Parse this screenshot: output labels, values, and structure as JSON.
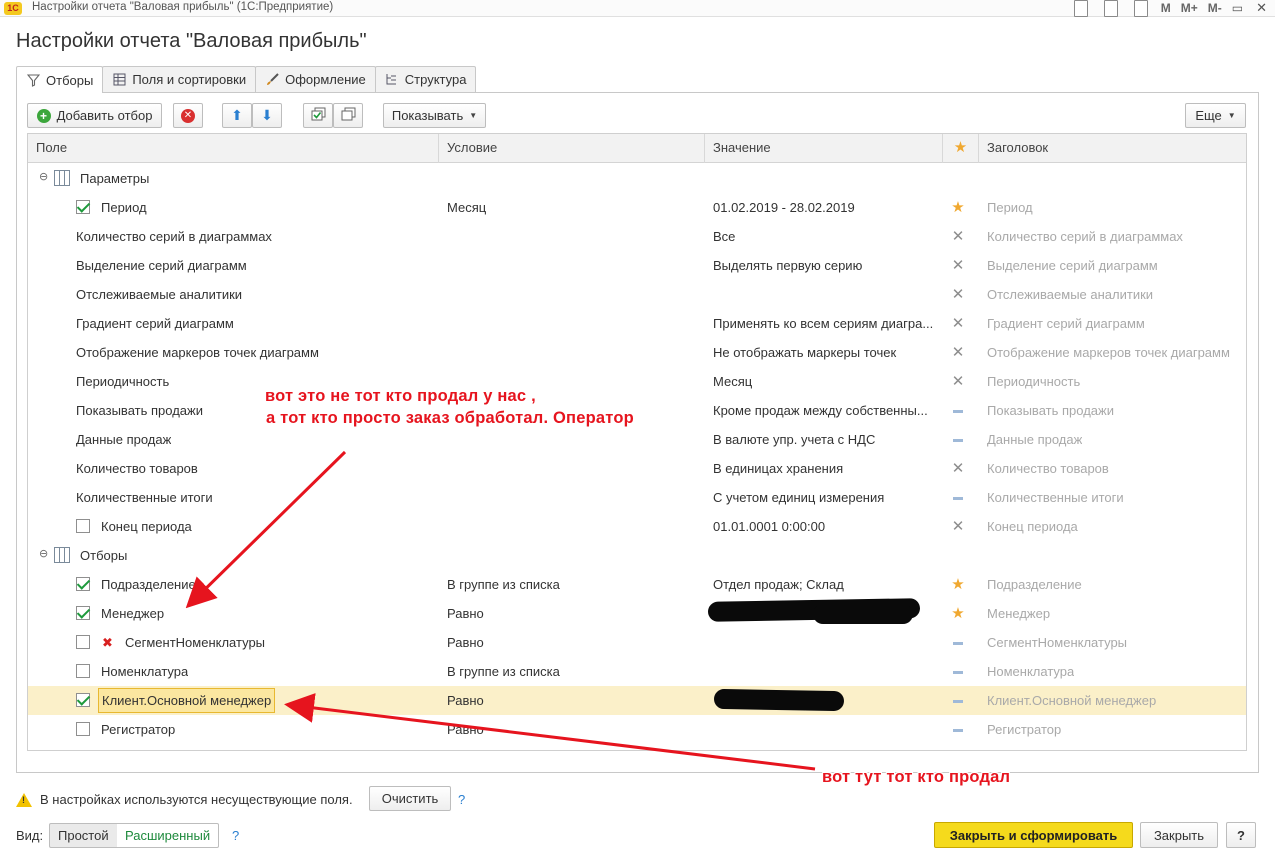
{
  "window": {
    "logo": "1С",
    "title": "Настройки отчета \"Валовая прибыль\"  (1С:Предприятие)",
    "toolbar_icons": [
      "M",
      "M+",
      "M-"
    ]
  },
  "page_title": "Настройки отчета \"Валовая прибыль\"",
  "tabs": [
    {
      "label": "Отборы",
      "icon": "filter-icon"
    },
    {
      "label": "Поля и сортировки",
      "icon": "fields-icon"
    },
    {
      "label": "Оформление",
      "icon": "brush-icon"
    },
    {
      "label": "Структура",
      "icon": "structure-icon"
    }
  ],
  "toolbar": {
    "add_filter": "Добавить отбор",
    "show": "Показывать",
    "more": "Еще"
  },
  "columns": {
    "field": "Поле",
    "condition": "Условие",
    "value": "Значение",
    "title": "Заголовок"
  },
  "groups": {
    "params": "Параметры",
    "filters": "Отборы"
  },
  "rows": [
    {
      "field": "Период",
      "condition": "Месяц",
      "value": "01.02.2019 - 28.02.2019",
      "mark": "star",
      "title": "Период"
    },
    {
      "field": "Количество серий в диаграммах",
      "condition": "",
      "value": "Все",
      "mark": "x",
      "title": "Количество серий в диаграммах"
    },
    {
      "field": "Выделение серий диаграмм",
      "condition": "",
      "value": "Выделять первую серию",
      "mark": "x",
      "title": "Выделение серий диаграмм"
    },
    {
      "field": "Отслеживаемые аналитики",
      "condition": "",
      "value": "",
      "mark": "x",
      "title": "Отслеживаемые аналитики"
    },
    {
      "field": "Градиент серий диаграмм",
      "condition": "",
      "value": "Применять ко всем сериям диагра...",
      "mark": "x",
      "title": "Градиент серий диаграмм"
    },
    {
      "field": "Отображение маркеров точек диаграмм",
      "condition": "",
      "value": "Не отображать маркеры точек",
      "mark": "x",
      "title": "Отображение маркеров точек диаграмм"
    },
    {
      "field": "Периодичность",
      "condition": "",
      "value": "Месяц",
      "mark": "x",
      "title": "Периодичность"
    },
    {
      "field": "Показывать продажи",
      "condition": "",
      "value": "Кроме продаж между собственны...",
      "mark": "dash",
      "title": "Показывать продажи"
    },
    {
      "field": "Данные продаж",
      "condition": "",
      "value": "В валюте упр. учета с НДС",
      "mark": "dash",
      "title": "Данные продаж"
    },
    {
      "field": "Количество товаров",
      "condition": "",
      "value": "В единицах хранения",
      "mark": "x",
      "title": "Количество товаров"
    },
    {
      "field": "Количественные итоги",
      "condition": "",
      "value": "С учетом единиц измерения",
      "mark": "dash",
      "title": "Количественные итоги"
    },
    {
      "field": "Конец периода",
      "condition": "",
      "value": "01.01.0001 0:00:00",
      "mark": "x",
      "title": "Конец периода"
    },
    {
      "field": "Подразделение",
      "condition": "В группе из списка",
      "value": "Отдел продаж; Склад",
      "mark": "star",
      "title": "Подразделение"
    },
    {
      "field": "Менеджер",
      "condition": "Равно",
      "value": "",
      "mark": "star",
      "title": "Менеджер"
    },
    {
      "field": "СегментНоменклатуры",
      "condition": "Равно",
      "value": "",
      "mark": "dash",
      "title": "СегментНоменклатуры"
    },
    {
      "field": "Номенклатура",
      "condition": "В группе из списка",
      "value": "",
      "mark": "dash",
      "title": "Номенклатура"
    },
    {
      "field": "Клиент.Основной менеджер",
      "condition": "Равно",
      "value": "",
      "mark": "dash",
      "title": "Клиент.Основной менеджер"
    },
    {
      "field": "Регистратор",
      "condition": "Равно",
      "value": "",
      "mark": "dash",
      "title": "Регистратор"
    }
  ],
  "footer": {
    "warning": "В настройках используются несуществующие поля.",
    "clear": "Очистить",
    "help": "?",
    "view_label": "Вид:",
    "simple": "Простой",
    "extended": "Расширенный",
    "close_generate": "Закрыть и сформировать",
    "close": "Закрыть"
  },
  "annotations": {
    "top_line1": "вот это не тот кто продал у нас ,",
    "top_line2": " а тот кто просто заказ обработал. Оператор",
    "bottom": "вот тут тот кто продал"
  },
  "colors": {
    "accent_yellow": "#f5da1c",
    "selected_row": "#fbf0c9",
    "annotation_red": "#e6141e",
    "check_green": "#1e9a3c",
    "star": "#f0a830"
  }
}
